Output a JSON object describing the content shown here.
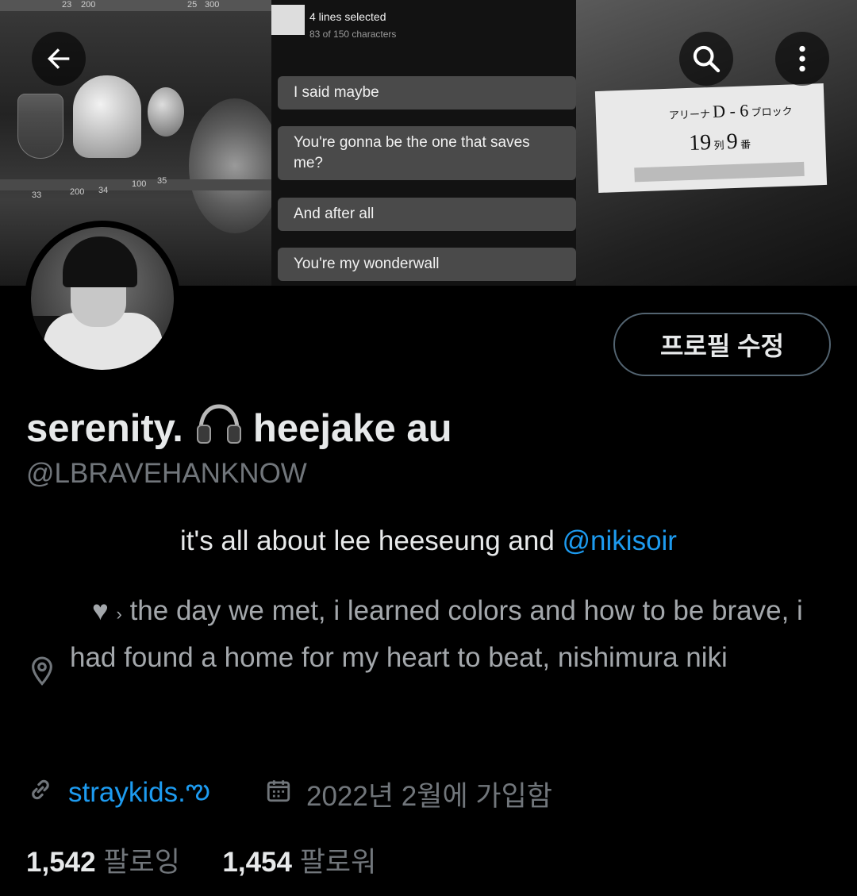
{
  "banner": {
    "left_prices": [
      "23",
      "200",
      "25",
      "300",
      "33",
      "200",
      "34",
      "100",
      "35"
    ],
    "chat": {
      "title": "4 lines selected",
      "subtitle": "83 of 150 characters",
      "messages": [
        "I said maybe",
        "You're gonna be the one that saves me?",
        "And after all",
        "You're my wonderwall"
      ]
    },
    "ticket": {
      "row1_prefix": "アリーナ",
      "row1_block": "D - 6",
      "row1_suffix": "ブロック",
      "row2_num": "19",
      "row2_mid": "列",
      "row2_seat": "9",
      "row2_suffix": "番"
    }
  },
  "header": {
    "back_icon": "arrow-left-icon",
    "search_icon": "search-icon",
    "more_icon": "more-vertical-icon"
  },
  "profile": {
    "edit_button": "프로필 수정",
    "name_part1": "serenity.",
    "name_part2": "heejake au",
    "handle": "@LBRAVEHANKNOW",
    "bio_line1_text": "it's all about lee heeseung and ",
    "bio_line1_mention": "@nikisoir",
    "bio_heart": "♥",
    "bio_sep": "›",
    "bio_line2": "the day we met, i learned colors and how to be brave, i had found a home for my heart to beat, nishimura niki",
    "website": "straykids.",
    "website_suffix": "ఌ",
    "joined": "2022년 2월에 가입함",
    "following_count": "1,542",
    "following_label": "팔로잉",
    "followers_count": "1,454",
    "followers_label": "팔로워"
  },
  "colors": {
    "background": "#000000",
    "primary_text": "#e7e9ea",
    "secondary_text": "#71767b",
    "link": "#1d9bf0",
    "button_border": "#536471"
  }
}
